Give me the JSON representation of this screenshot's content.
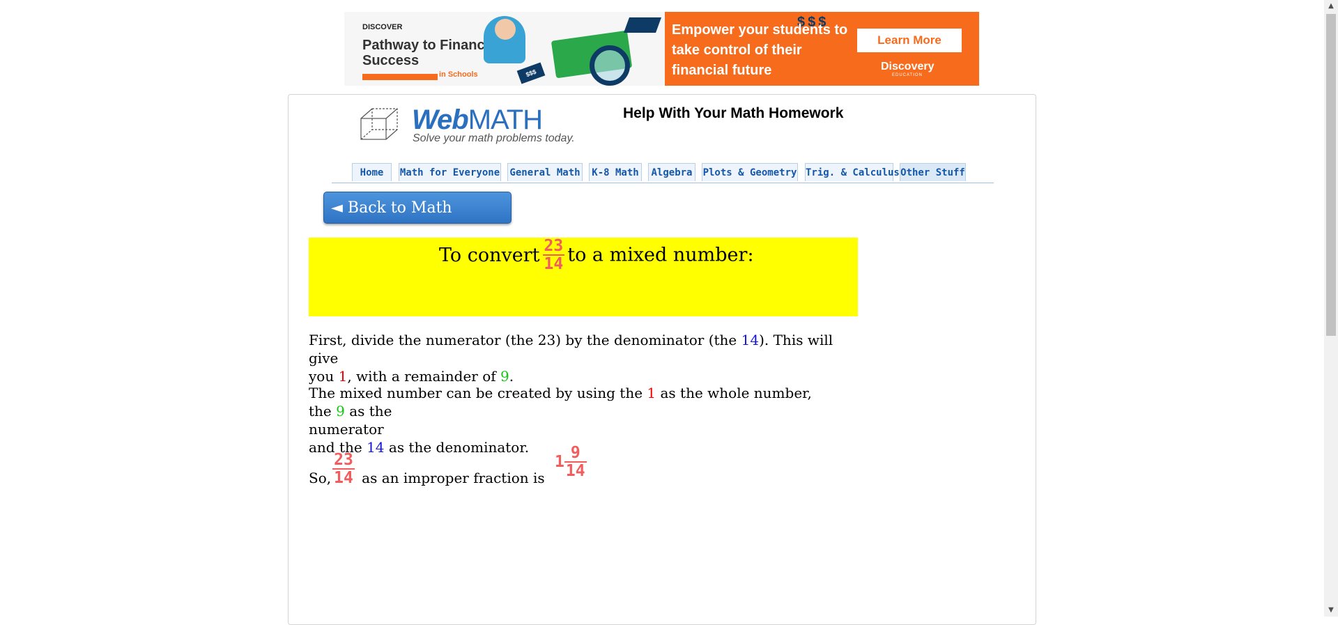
{
  "ad": {
    "brand": "DISCOVER",
    "headline": "Pathway to Financial Success",
    "sub": "in Schools",
    "tag": "$$$",
    "tagline": "Empower your students to take control of their financial future",
    "cta": "Learn More",
    "partner": "Discovery",
    "partner_sub": "EDUCATION",
    "colors": {
      "orange": "#f76b1c",
      "navy": "#0d3b66"
    }
  },
  "site": {
    "logo_web": "Web",
    "logo_math": "MATH",
    "logo_sub": "Solve your math problems today.",
    "page_title": "Help With Your Math Homework"
  },
  "nav": [
    {
      "label": "Home"
    },
    {
      "label": "Math for Everyone"
    },
    {
      "label": "General Math"
    },
    {
      "label": "K-8 Math"
    },
    {
      "label": "Algebra"
    },
    {
      "label": "Plots & Geometry"
    },
    {
      "label": "Trig. & Calculus"
    },
    {
      "label": "Other Stuff"
    }
  ],
  "back_button": "◄ Back to Math Problem",
  "problem": {
    "prefix": "To convert",
    "numerator": "23",
    "denominator": "14",
    "suffix": "to a mixed number:",
    "highlight_color": "#ffff00"
  },
  "step1": {
    "a": "First, divide the numerator (the 23) by the denominator (the ",
    "den": "14",
    "b": "). This will give",
    "c": "you ",
    "whole": "1",
    "d": ", with a remainder of ",
    "rem": "9",
    "e": "."
  },
  "step2": {
    "a": "The mixed number can be created by using the ",
    "whole": "1",
    "b": " as the whole number, the ",
    "rem": "9",
    "c": " as the",
    "d": "numerator",
    "e": "and the ",
    "den": "14",
    "f": " as the denominator."
  },
  "answer": {
    "prefix": "So,",
    "numerator": "23",
    "denominator": "14",
    "middle": "as an improper fraction is",
    "whole": "1",
    "mixed_numerator": "9",
    "mixed_denominator": "14"
  },
  "scrollbar": {
    "up": "▲",
    "down": "▼"
  }
}
